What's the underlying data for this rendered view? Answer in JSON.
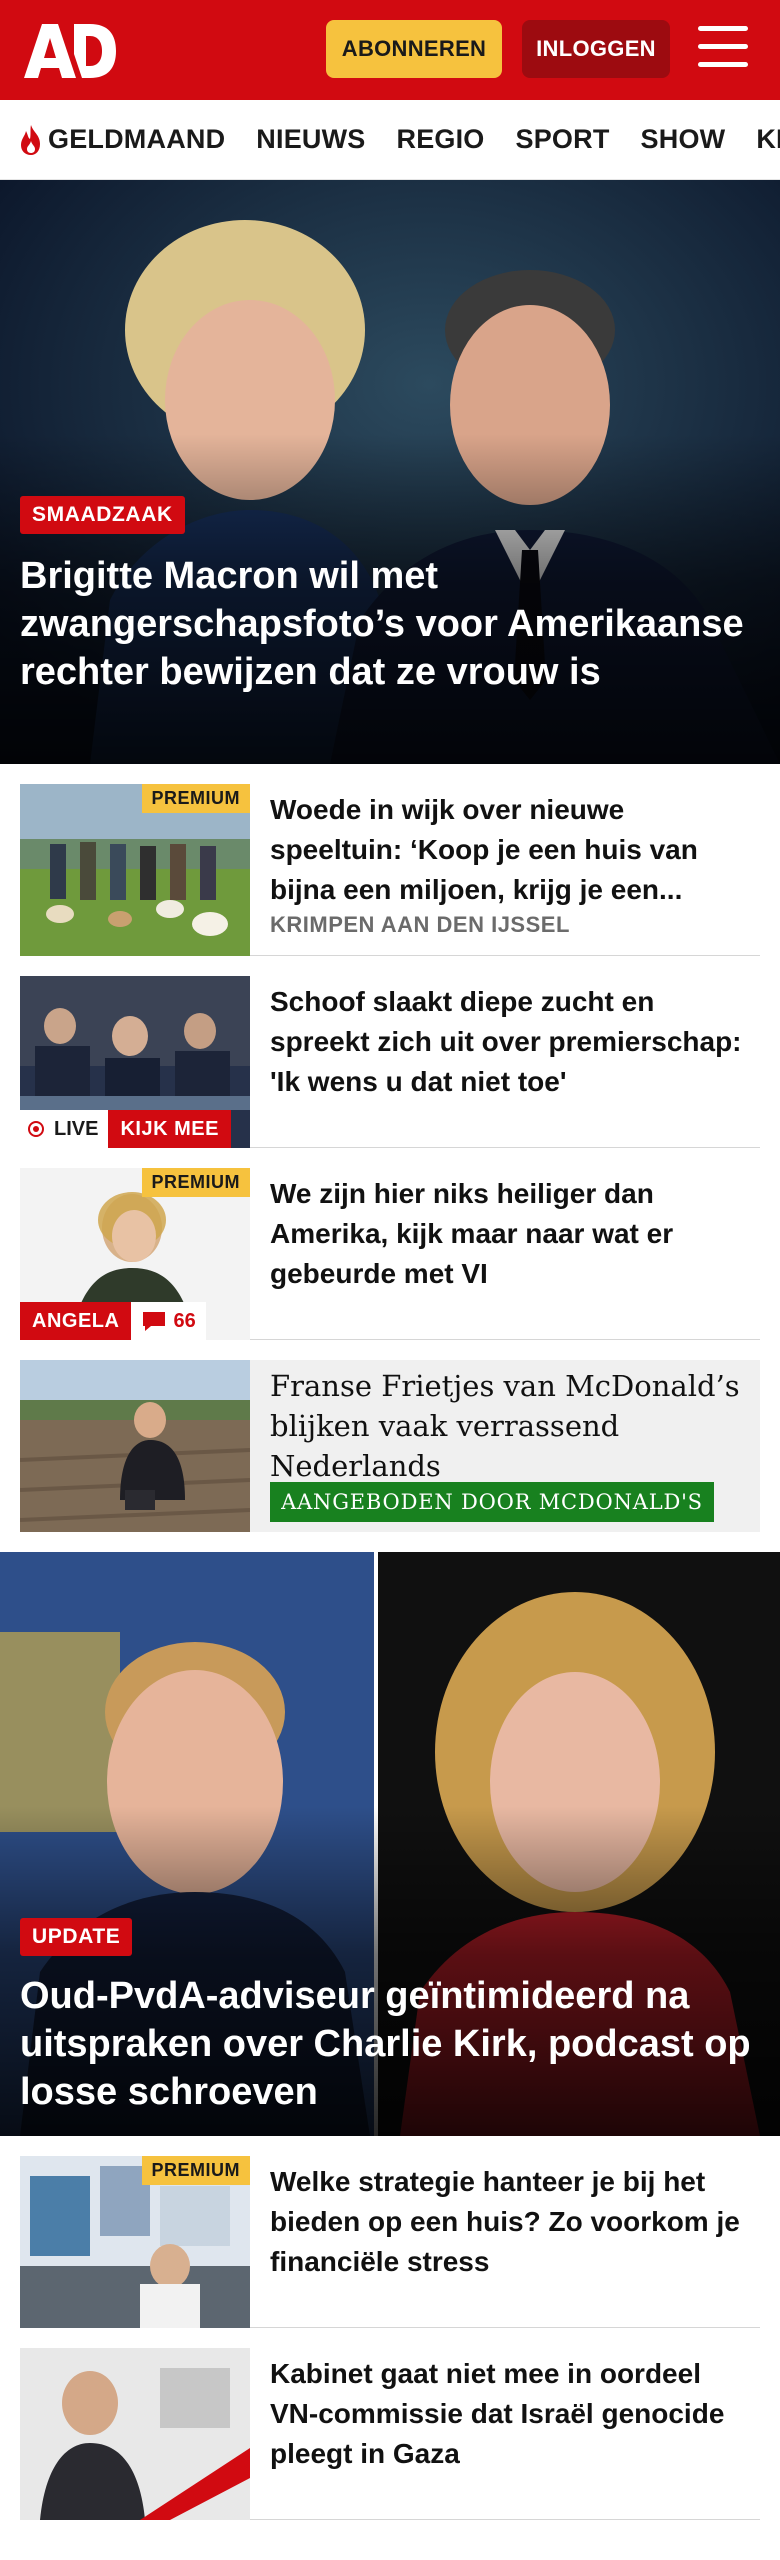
{
  "header": {
    "logo_text": "AD",
    "subscribe_label": "ABONNEREN",
    "login_label": "INLOGGEN",
    "menu_icon": "hamburger-menu-icon"
  },
  "nav": {
    "items": [
      {
        "label": "GELDMAAND",
        "icon": "flame-icon"
      },
      {
        "label": "NIEUWS"
      },
      {
        "label": "REGIO"
      },
      {
        "label": "SPORT"
      },
      {
        "label": "SHOW"
      },
      {
        "label": "KIJK"
      }
    ]
  },
  "hero1": {
    "label": "SMAADZAAK",
    "title": "Brigitte Macron wil met zwangerschapsfoto’s voor Amerikaanse rechter bewijzen dat ze vrouw is"
  },
  "articles": [
    {
      "premium": "PREMIUM",
      "title": "Woede in wijk over nieuwe speeltuin: ‘Koop je een huis van bijna een miljoen, krijg je een...",
      "meta": "KRIMPEN AAN DEN IJSSEL"
    },
    {
      "title": "Schoof slaakt diepe zucht en spreekt zich uit over premier­schap: 'Ik wens u dat niet toe'",
      "live_label": "LIVE",
      "watch_label": "KIJK MEE"
    },
    {
      "premium": "PREMIUM",
      "title": "We zijn hier niks heiliger dan Amerika, kijk maar naar wat er gebeurde met VI",
      "author": "ANGELA",
      "comments": "66"
    },
    {
      "title": "Franse Frietjes van McDonald’s blijken vaak verrassend Nederlands",
      "sponsor": "AANGEBODEN DOOR MCDONALD'S"
    }
  ],
  "hero2": {
    "label": "UPDATE",
    "title": "Oud-PvdA-adviseur geïntimideerd na uitspraken over Charlie Kirk, podcast op losse schroeven"
  },
  "articles2": [
    {
      "premium": "PREMIUM",
      "title": "Welke strategie hanteer je bij het bieden op een huis? Zo voorkom je financiële stress"
    },
    {
      "title": "Kabinet gaat niet mee in oordeel VN-commissie dat Israël genocide pleegt in Gaza"
    }
  ],
  "colors": {
    "brand_red": "#d10a11",
    "subscribe_yellow": "#f6c23e",
    "login_dark_red": "#9d0b10",
    "sponsor_green": "#18811f"
  }
}
